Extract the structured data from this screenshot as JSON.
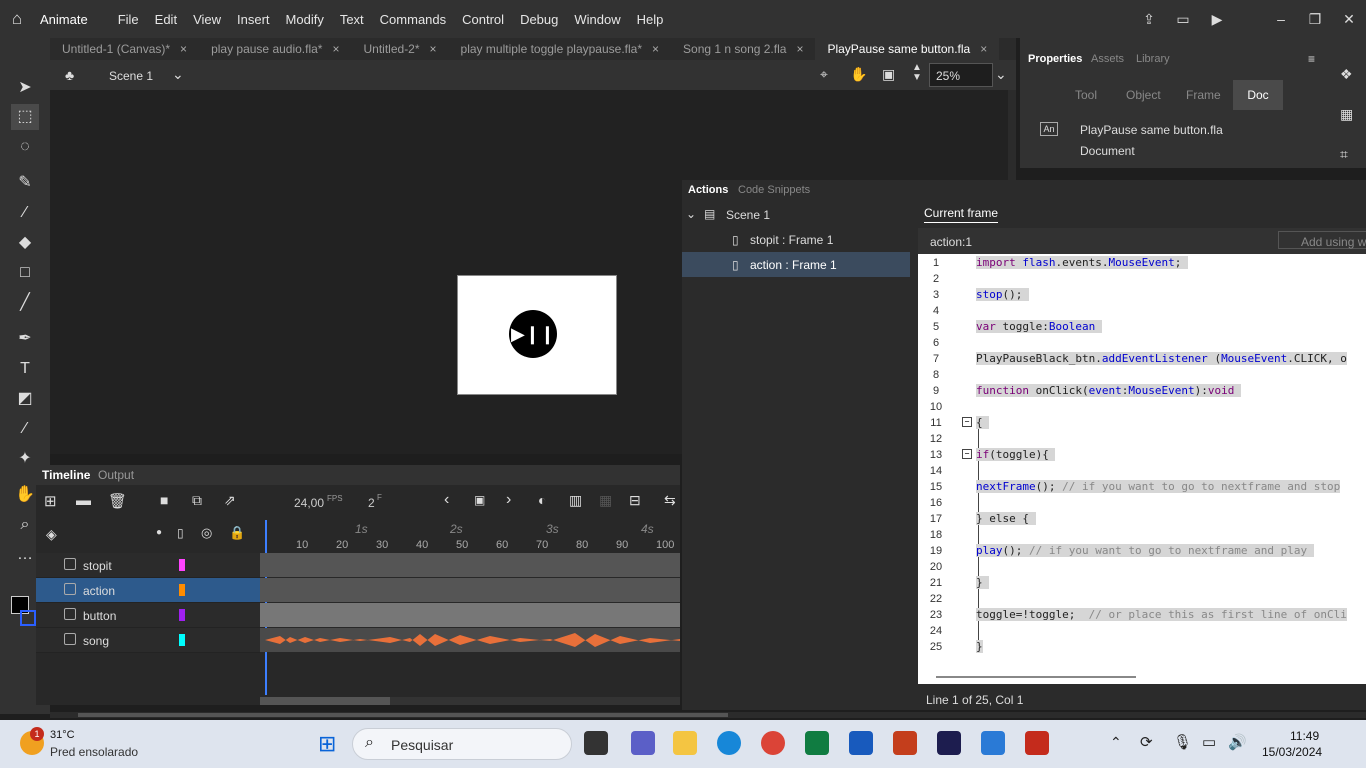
{
  "menu": {
    "app": "Animate",
    "items": [
      "File",
      "Edit",
      "View",
      "Insert",
      "Modify",
      "Text",
      "Commands",
      "Control",
      "Debug",
      "Window",
      "Help"
    ]
  },
  "tabs": [
    {
      "label": "Untitled-1 (Canvas)*"
    },
    {
      "label": "play pause audio.fla*"
    },
    {
      "label": "Untitled-2*"
    },
    {
      "label": "play multiple toggle playpause.fla*"
    },
    {
      "label": "Song 1 n song 2.fla"
    },
    {
      "label": "PlayPause same button.fla"
    }
  ],
  "tab_close": "×",
  "scene": {
    "name": "Scene 1",
    "zoom": "25%"
  },
  "timeline": {
    "tab": "Timeline",
    "tab2": "Output",
    "fps": "24,00",
    "fps_unit": "FPS",
    "frame": "2",
    "frame_unit": "F",
    "ruler_secs": [
      "1s",
      "2s",
      "3s",
      "4s"
    ],
    "ruler_nums": [
      "10",
      "20",
      "30",
      "40",
      "50",
      "60",
      "70",
      "80",
      "90",
      "100"
    ],
    "layers": [
      {
        "name": "stopit",
        "color": "#ff44ff"
      },
      {
        "name": "action",
        "color": "#ff8c00"
      },
      {
        "name": "button",
        "color": "#a020f0"
      },
      {
        "name": "song",
        "color": "#00ffff"
      }
    ]
  },
  "properties": {
    "tabs": [
      "Properties",
      "Assets",
      "Library"
    ],
    "modes": [
      "Tool",
      "Object",
      "Frame",
      "Doc"
    ],
    "filename": "PlayPause same button.fla",
    "type": "Document",
    "badge": "An"
  },
  "actions": {
    "tab": "Actions",
    "tab2": "Code Snippets",
    "tree_root": "Scene 1",
    "tree_items": [
      "stopit : Frame 1",
      "action : Frame 1"
    ],
    "current": "Current frame",
    "frame_label": "action:1",
    "add_wizard": "Add using wiz",
    "status": "Line 1 of 25, Col 1"
  },
  "code": {
    "l1a": "import ",
    "l1b": "flash",
    "l1c": ".events.",
    "l1d": "MouseEvent",
    ";": ";",
    "l3a": "stop",
    "l3b": "();",
    "l5a": "var ",
    "l5b": "toggle:",
    "l5c": "Boolean",
    "l7a": "PlayPauseBlack_btn.",
    "l7b": "addEventListener ",
    "l7c": "(",
    "l7d": "MouseEvent",
    ".CLICK, o": ".CLICK, o",
    "l9a": "function ",
    "l9b": "onClick(",
    "l9c": "event",
    ":": ":",
    "l9d": "MouseEvent",
    "l9e": "):",
    "l9f": "void",
    "l11": "{",
    "l13a": "if",
    "l13b": "(toggle){",
    "l15a": "nextFrame",
    "l15b": "(); ",
    "l15c": "// if you want to go to nextframe and stop",
    "l17": "} else {",
    "l19a": "play",
    "l19b": "(); ",
    "l19c": "// if you want to go to nextframe and play",
    "l21": "}",
    "l23a": "toggle=!toggle;  ",
    "l23b": "// or place this as first line of onCli",
    "l25": "}"
  },
  "taskbar": {
    "temp": "31°C",
    "weather": "Pred ensolarado",
    "badge": "1",
    "search": "Pesquisar",
    "time": "11:49",
    "date": "15/03/2024"
  }
}
